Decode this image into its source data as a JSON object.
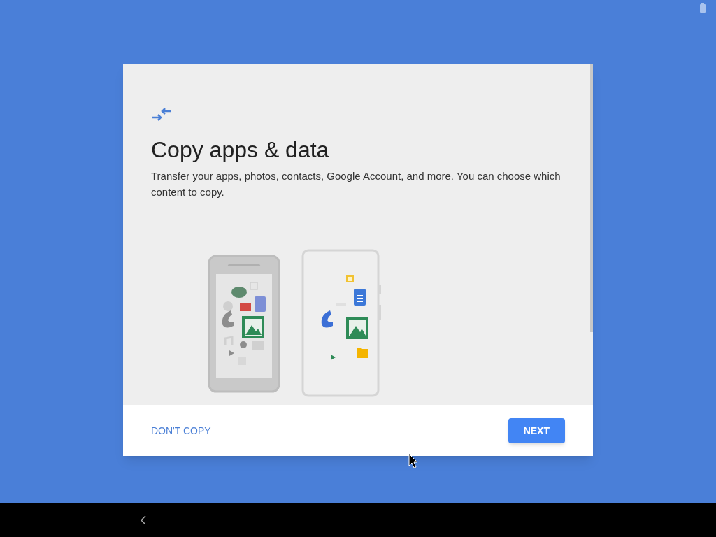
{
  "dialog": {
    "title": "Copy apps & data",
    "description": "Transfer your apps, photos, contacts, Google Account, and more. You can choose which content to copy.",
    "buttons": [
      {
        "label": "DON'T COPY",
        "kind": "text"
      },
      {
        "label": "NEXT",
        "kind": "filled"
      }
    ]
  }
}
